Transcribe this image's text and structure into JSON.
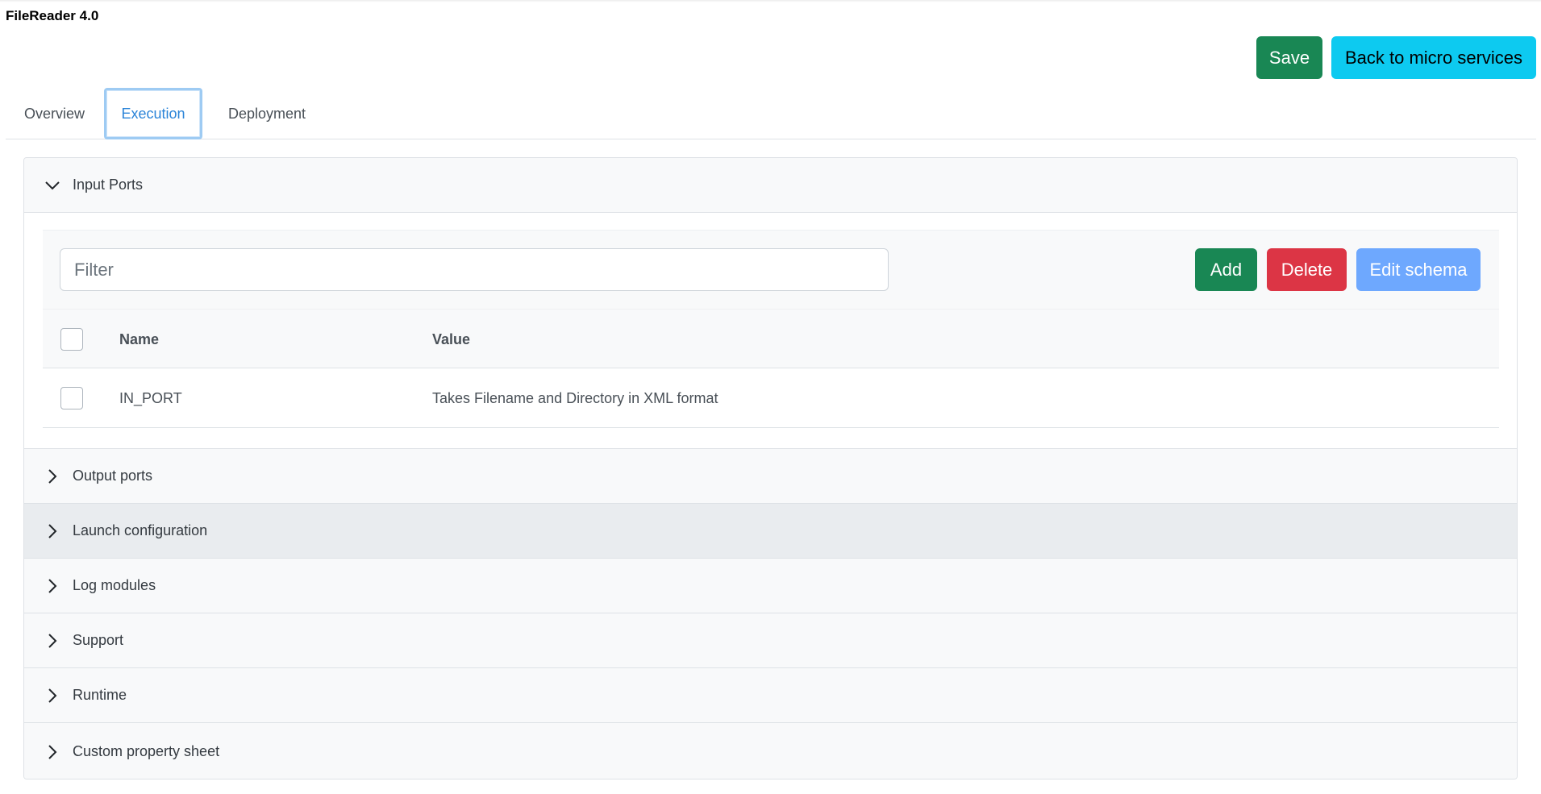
{
  "app": {
    "title": "FileReader 4.0"
  },
  "header": {
    "save_label": "Save",
    "back_label": "Back to micro services"
  },
  "tabs": [
    {
      "label": "Overview",
      "active": false
    },
    {
      "label": "Execution",
      "active": true
    },
    {
      "label": "Deployment",
      "active": false
    }
  ],
  "sections": {
    "input_ports": {
      "title": "Input Ports",
      "expanded": true,
      "filter_placeholder": "Filter",
      "add_label": "Add",
      "delete_label": "Delete",
      "edit_schema_label": "Edit schema",
      "columns": {
        "name": "Name",
        "value": "Value"
      },
      "rows": [
        {
          "name": "IN_PORT",
          "value": "Takes Filename and Directory in XML format",
          "checked": false
        }
      ]
    },
    "output_ports": {
      "title": "Output ports"
    },
    "launch_configuration": {
      "title": "Launch configuration"
    },
    "log_modules": {
      "title": "Log modules"
    },
    "support": {
      "title": "Support"
    },
    "runtime": {
      "title": "Runtime"
    },
    "custom_property_sheet": {
      "title": "Custom property sheet"
    }
  },
  "colors": {
    "success": "#198754",
    "info": "#0dcaf0",
    "danger": "#dc3545",
    "primary_light": "#6ea8fe",
    "active_tab": "#2b84d8"
  },
  "icons": {
    "expanded": "chevron-down-icon",
    "collapsed": "chevron-right-icon"
  }
}
